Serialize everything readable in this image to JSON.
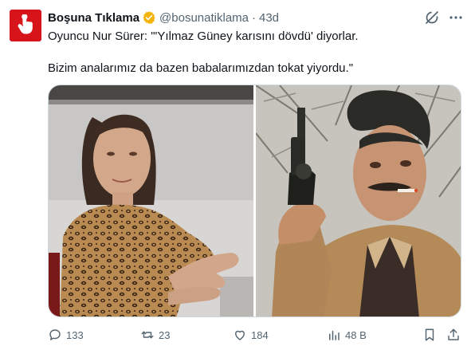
{
  "author": {
    "name": "Boşuna Tıklama",
    "handle": "@bosunatiklama",
    "time": "43d",
    "separator": "·",
    "avatar_icon": "hand-pointer-icon",
    "verified_icon": "verified-badge-icon",
    "badge_color": "#f5b40a"
  },
  "tweet": {
    "line1": "Oyuncu Nur Sürer: \"'Yılmaz Güney karısını dövdü' diyorlar.",
    "line2": "Bizim analarımız da bazen babalarımızdan tokat yiyordu.\""
  },
  "media": {
    "left_photo": "woman-in-leopard-print-top-photo",
    "right_photo": "man-with-revolver-and-cigarette-photo"
  },
  "actions": {
    "replies": "133",
    "reposts": "23",
    "likes": "184",
    "views": "48 B"
  },
  "colors": {
    "brand_red": "#d7141a",
    "text": "#0f1419",
    "muted": "#536471",
    "border": "#cfd9de"
  }
}
